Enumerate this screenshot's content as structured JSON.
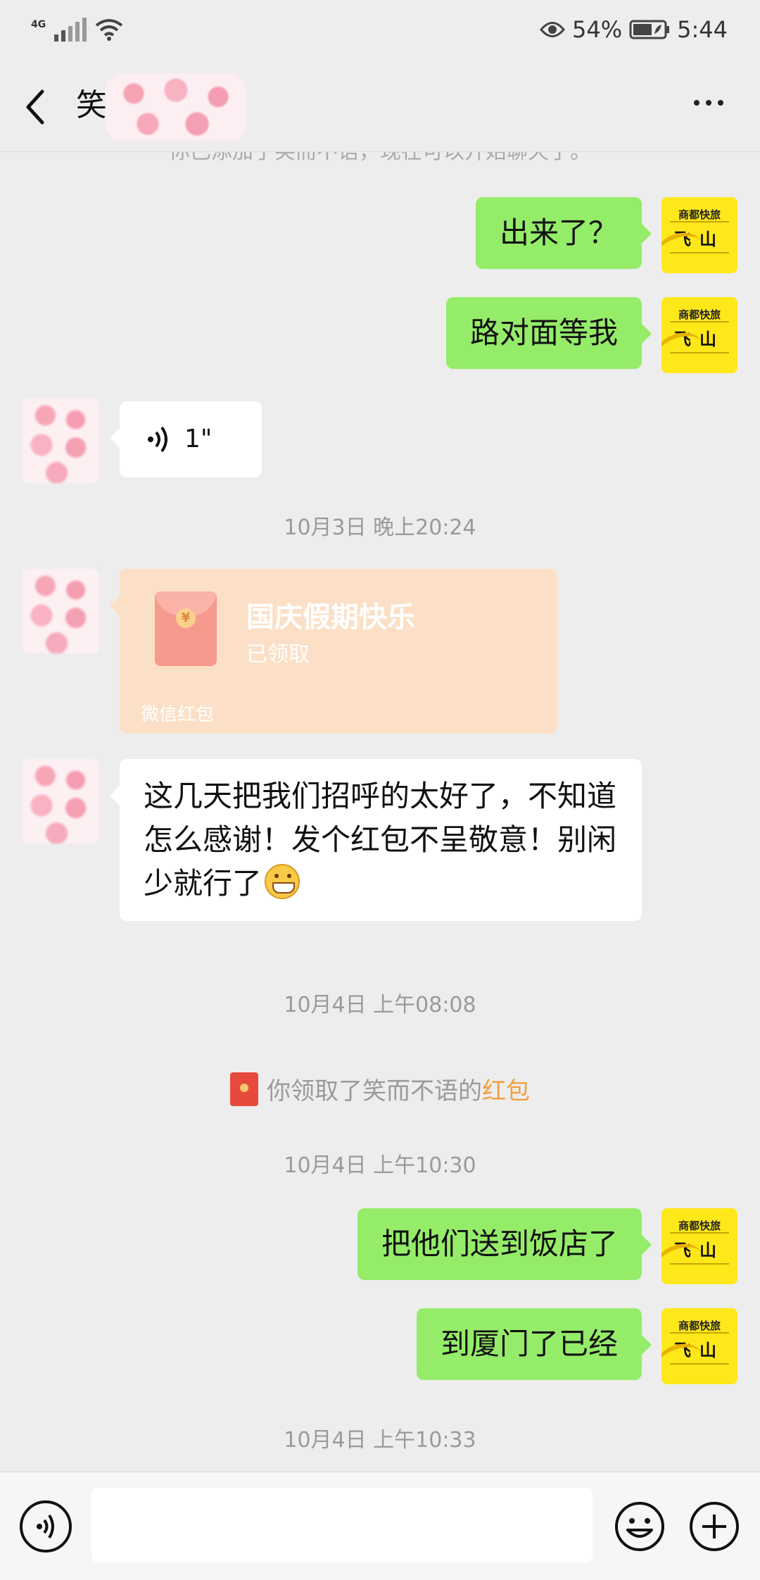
{
  "status_bar": {
    "network": "4G",
    "battery_percent": "54%",
    "time": "5:44"
  },
  "nav": {
    "title_visible": "笑"
  },
  "chat": {
    "system_cut_text": "你已添加了笑而不语，现在可以开始聊天了。",
    "messages": {
      "m1": "出来了？",
      "m2": "路对面等我",
      "voice_duration": "1\"",
      "time1": "10月3日 晚上20:24",
      "redpacket_title": "国庆假期快乐",
      "redpacket_status": "已领取",
      "redpacket_footer": "微信红包",
      "m_thanks": "这几天把我们招呼的太好了，不知道怎么感谢！发个红包不呈敬意！别闲少就行了",
      "time2": "10月4日 上午08:08",
      "sys_received_prefix": "你领取了笑而不语的",
      "sys_received_link": "红包",
      "time3": "10月4日 上午10:30",
      "m3": "把他们送到饭店了",
      "m4": "到厦门了已经",
      "time4": "10月4日 上午10:33"
    }
  },
  "avatar_me": {
    "line1": "商都快旅",
    "line2": "飞山"
  },
  "colors": {
    "my_bubble": "#95ec69",
    "their_bubble": "#ffffff",
    "background": "#ededed",
    "redpacket_received": "#fbe0c7",
    "link_orange": "#f0a040",
    "my_avatar_bg": "#ffe81a"
  },
  "icons": {
    "back": "back-arrow-icon",
    "more": "more-dots-icon",
    "voice_input": "voice-icon",
    "emoji": "emoji-icon",
    "plus": "plus-icon"
  }
}
